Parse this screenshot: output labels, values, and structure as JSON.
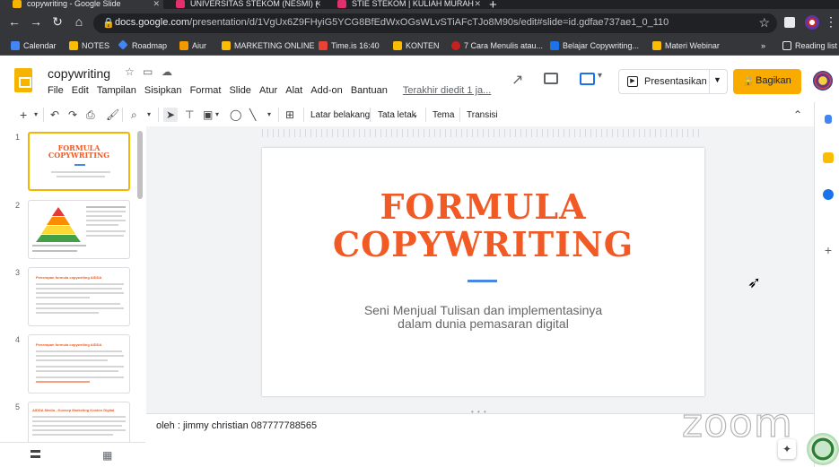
{
  "browser": {
    "tabs": [
      {
        "label": "copywriting - Google Slide",
        "color": "#f4b400"
      },
      {
        "label": "UNIVERSITAS STEKOM (NESMI) (",
        "color": "#e1306c"
      },
      {
        "label": "STIE STEKOM | KULIAH MURAH",
        "color": "#e1306c"
      }
    ],
    "url_host": "docs.google.com",
    "url_path": "/presentation/d/1VgUx6Z9FHyiG5YCG8BfEdWxOGsWLvSTiAFcTJo8M90s/edit#slide=id.gdfae737ae1_0_110",
    "bookmarks": [
      {
        "label": "Calendar",
        "color": "#4285f4"
      },
      {
        "label": "NOTES",
        "color": "#fbbc04"
      },
      {
        "label": "Roadmap",
        "color": "#4285f4"
      },
      {
        "label": "Aiur",
        "color": "#f29900"
      },
      {
        "label": "MARKETING ONLINE",
        "color": "#fbbc04"
      },
      {
        "label": "Time.is 16:40",
        "color": "#ea4335"
      },
      {
        "label": "KONTEN",
        "color": "#fbbc04"
      },
      {
        "label": "7 Cara Menulis atau...",
        "color": "#c5221f"
      },
      {
        "label": "Belajar Copywriting...",
        "color": "#1a73e8"
      },
      {
        "label": "Materi Webinar",
        "color": "#fbbc04"
      },
      {
        "label": "»",
        "color": ""
      },
      {
        "label": "Reading list",
        "color": ""
      }
    ]
  },
  "doc": {
    "title": "copywriting",
    "menus": [
      "File",
      "Edit",
      "Tampilan",
      "Sisipkan",
      "Format",
      "Slide",
      "Atur",
      "Alat",
      "Add-on",
      "Bantuan"
    ],
    "last_edit": "Terakhir diedit 1 ja...",
    "present_label": "Presentasikan",
    "share_label": "Bagikan"
  },
  "toolbar": {
    "background": "Latar belakang",
    "layout": "Tata letak",
    "theme": "Tema",
    "transition": "Transisi"
  },
  "filmstrip": {
    "numbers": [
      "1",
      "2",
      "3",
      "4",
      "5"
    ],
    "slide1_title": "FORMULA COPYWRITING",
    "slide3_head": "Penerapan formula copywriting AIDDA",
    "slide4_head": "Penerapan formula copywriting AIDDA",
    "slide5_head": "AIDDA Media - Konsep Marketing Konten Digital"
  },
  "slide": {
    "title_line1": "FORMULA",
    "title_line2": "COPYWRITING",
    "subtitle_line1": "Seni Menjual Tulisan dan implementasinya",
    "subtitle_line2": "dalam dunia pemasaran digital",
    "title_color": "#f15a24",
    "accent_color": "#4a86e8"
  },
  "notes": {
    "text": "oleh : jimmy christian 087777788565"
  },
  "overlay": {
    "watermark": "zoom"
  }
}
